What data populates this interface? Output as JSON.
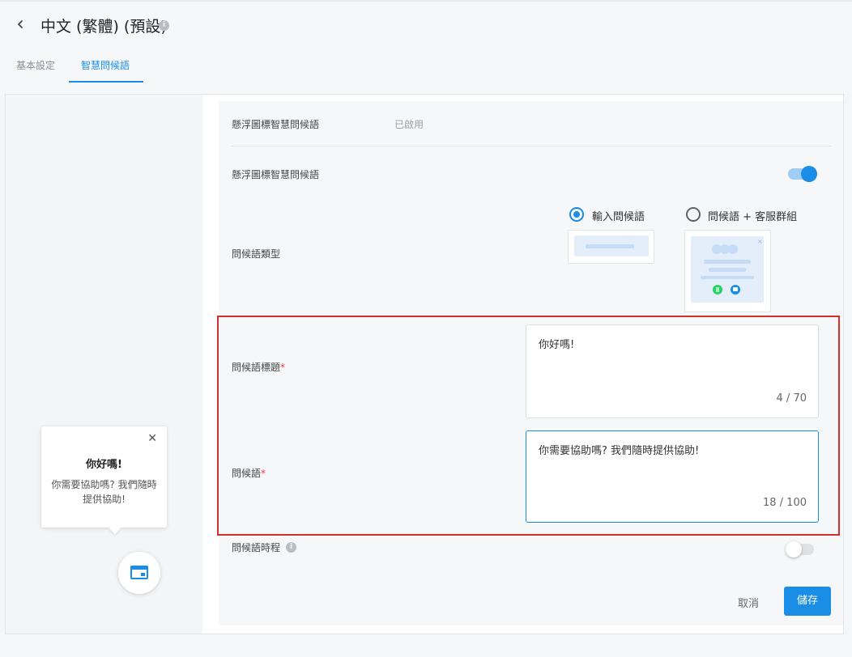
{
  "header": {
    "title": "中文 (繁體) (預設)",
    "info_icon": "info-circle-icon",
    "back_icon": "chevron-left-icon"
  },
  "tabs": [
    {
      "label": "基本設定",
      "active": false
    },
    {
      "label": "智慧問候語",
      "active": true
    }
  ],
  "preview": {
    "greeting_title": "你好嗎!",
    "greeting_message": "你需要協助嗎? 我們隨時提供協助!",
    "close_icon": "close-icon",
    "launcher_icon": "chat-window-icon"
  },
  "settings": {
    "status_label": "懸浮圖標智慧問候語",
    "status_value": "已啟用",
    "toggle_label": "懸浮圖標智慧問候語",
    "toggle_on": true,
    "type_label": "問候語類型",
    "type_options": [
      {
        "label": "輸入問候語",
        "selected": true
      },
      {
        "label": "問候語 + 客服群組",
        "selected": false
      }
    ],
    "title_field": {
      "label": "問候語標題",
      "required_mark": "*",
      "value": "你好嗎!",
      "counter": "4 / 70"
    },
    "message_field": {
      "label": "問候語",
      "required_mark": "*",
      "value": "你需要協助嗎? 我們隨時提供協助!",
      "counter": "18 / 100"
    },
    "schedule_label": "問候語時程",
    "schedule_on": false,
    "cancel_label": "取消",
    "save_label": "儲存"
  },
  "colors": {
    "accent": "#1a8ee6",
    "highlight_border": "#d32f2f",
    "whatsapp": "#25d366"
  }
}
